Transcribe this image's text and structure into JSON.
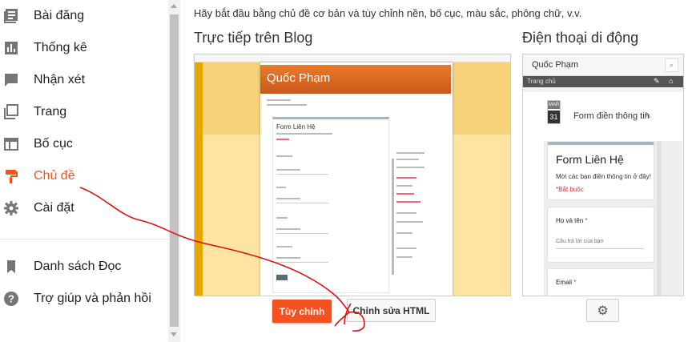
{
  "sidebar": {
    "items": [
      {
        "label": "Bài đăng",
        "icon": "posts-icon"
      },
      {
        "label": "Thống kê",
        "icon": "stats-icon"
      },
      {
        "label": "Nhận xét",
        "icon": "comments-icon"
      },
      {
        "label": "Trang",
        "icon": "pages-icon"
      },
      {
        "label": "Bố cục",
        "icon": "layout-icon"
      },
      {
        "label": "Chủ đề",
        "icon": "theme-icon"
      },
      {
        "label": "Cài đặt",
        "icon": "settings-icon"
      }
    ],
    "secondary": [
      {
        "label": "Danh sách Đọc",
        "icon": "bookmark-icon"
      },
      {
        "label": "Trợ giúp và phản hồi",
        "icon": "help-icon"
      }
    ],
    "active_color": "#f4511e"
  },
  "main": {
    "intro": "Hãy bắt đầu bằng chủ đề cơ bản và tùy chỉnh nền, bố cục, màu sắc, phông chữ, v.v.",
    "live_heading": "Trực tiếp trên Blog",
    "mobile_heading": "Điện thoại di động"
  },
  "blog_preview": {
    "blog_title": "Quốc Phạm",
    "form_title": "Form Liên Hệ",
    "header_color": "#e06c22"
  },
  "mobile_preview": {
    "blog_title": "Quốc Phạm",
    "nav_label": "Trang chủ",
    "date_month": "MAR",
    "date_day": "31",
    "post_title": "Form điền thông tin",
    "form_title": "Form Liên Hệ",
    "form_desc": "Mời các bạn điền thông tin ở đây!",
    "required_note": "*Bắt buộc",
    "q1_label": "Họ và tên",
    "q1_answer": "Câu trả lời của bạn",
    "q2_label": "Email"
  },
  "buttons": {
    "customize": "Tùy chỉnh",
    "edit_html": "Chỉnh sửa HTML"
  }
}
